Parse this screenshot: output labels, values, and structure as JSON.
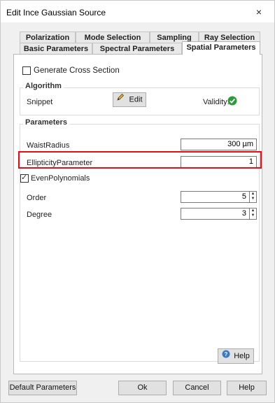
{
  "window": {
    "title": "Edit Ince Gaussian Source",
    "close_glyph": "×"
  },
  "tabs": {
    "row1": [
      "Polarization",
      "Mode Selection",
      "Sampling",
      "Ray Selection"
    ],
    "row2": [
      "Basic Parameters",
      "Spectral Parameters",
      "Spatial Parameters"
    ],
    "active": "Spatial Parameters"
  },
  "generate_cross_section": {
    "label": "Generate Cross Section",
    "checked": false
  },
  "algorithm": {
    "title": "Algorithm",
    "snippet_label": "Snippet",
    "edit_button": "Edit",
    "validity_label": "Validity:",
    "validity_icon": "green-check-icon"
  },
  "parameters": {
    "title": "Parameters",
    "waist_radius": {
      "label": "WaistRadius",
      "value": "300 µm"
    },
    "ellipticity": {
      "label": "EllipticityParameter",
      "value": "1"
    },
    "even_polynomials": {
      "label": "EvenPolynomials",
      "checked": true
    },
    "order": {
      "label": "Order",
      "value": "5"
    },
    "degree": {
      "label": "Degree",
      "value": "3"
    }
  },
  "help_button": "Help",
  "footer": {
    "default_parameters": "Default Parameters",
    "ok": "Ok",
    "cancel": "Cancel",
    "help": "Help"
  },
  "colors": {
    "highlight": "#e0101a",
    "validity": "#2e9b3a",
    "help_icon": "#3a78c8"
  }
}
